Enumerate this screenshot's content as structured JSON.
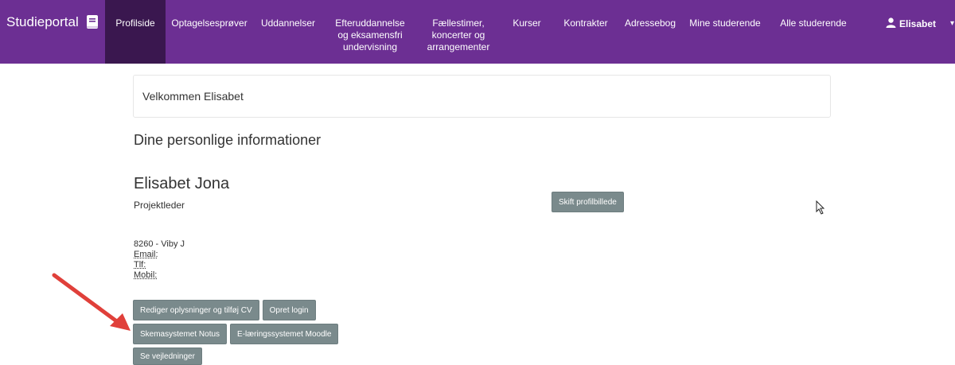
{
  "brand": {
    "name": "Studieportal",
    "icon": "book-icon"
  },
  "nav": [
    {
      "label": "Profilside",
      "active": true
    },
    {
      "label": "Optagelsesprøver"
    },
    {
      "label": "Uddannelser"
    },
    {
      "label": "Efteruddannelse og eksamensfri undervisning"
    },
    {
      "label": "Fællestimer, koncerter og arrangementer"
    },
    {
      "label": "Kurser"
    },
    {
      "label": "Kontrakter"
    },
    {
      "label": "Adressebog"
    },
    {
      "label": "Mine studerende"
    },
    {
      "label": "Alle studerende"
    }
  ],
  "user": {
    "name": "Elisabet",
    "icon": "user-icon"
  },
  "welcome": "Velkommen Elisabet",
  "section_title": "Dine personlige informationer",
  "profile": {
    "name": "Elisabet Jona",
    "title": "Projektleder",
    "change_photo": "Skift profilbillede",
    "address": "8260 - Viby J",
    "email_label": "Email:",
    "phone_label": "Tlf:",
    "mobile_label": "Mobil:"
  },
  "buttons": {
    "edit": "Rediger oplysninger og tilføj CV",
    "create_login": "Opret login",
    "notus": "Skemasystemet Notus",
    "moodle": "E-læringssystemet Moodle",
    "guides": "Se vejledninger"
  },
  "colors": {
    "nav_bg": "#6c2f93",
    "nav_active": "#3a174f",
    "button": "#7a8a8c",
    "annotation_arrow": "#e0403a"
  }
}
